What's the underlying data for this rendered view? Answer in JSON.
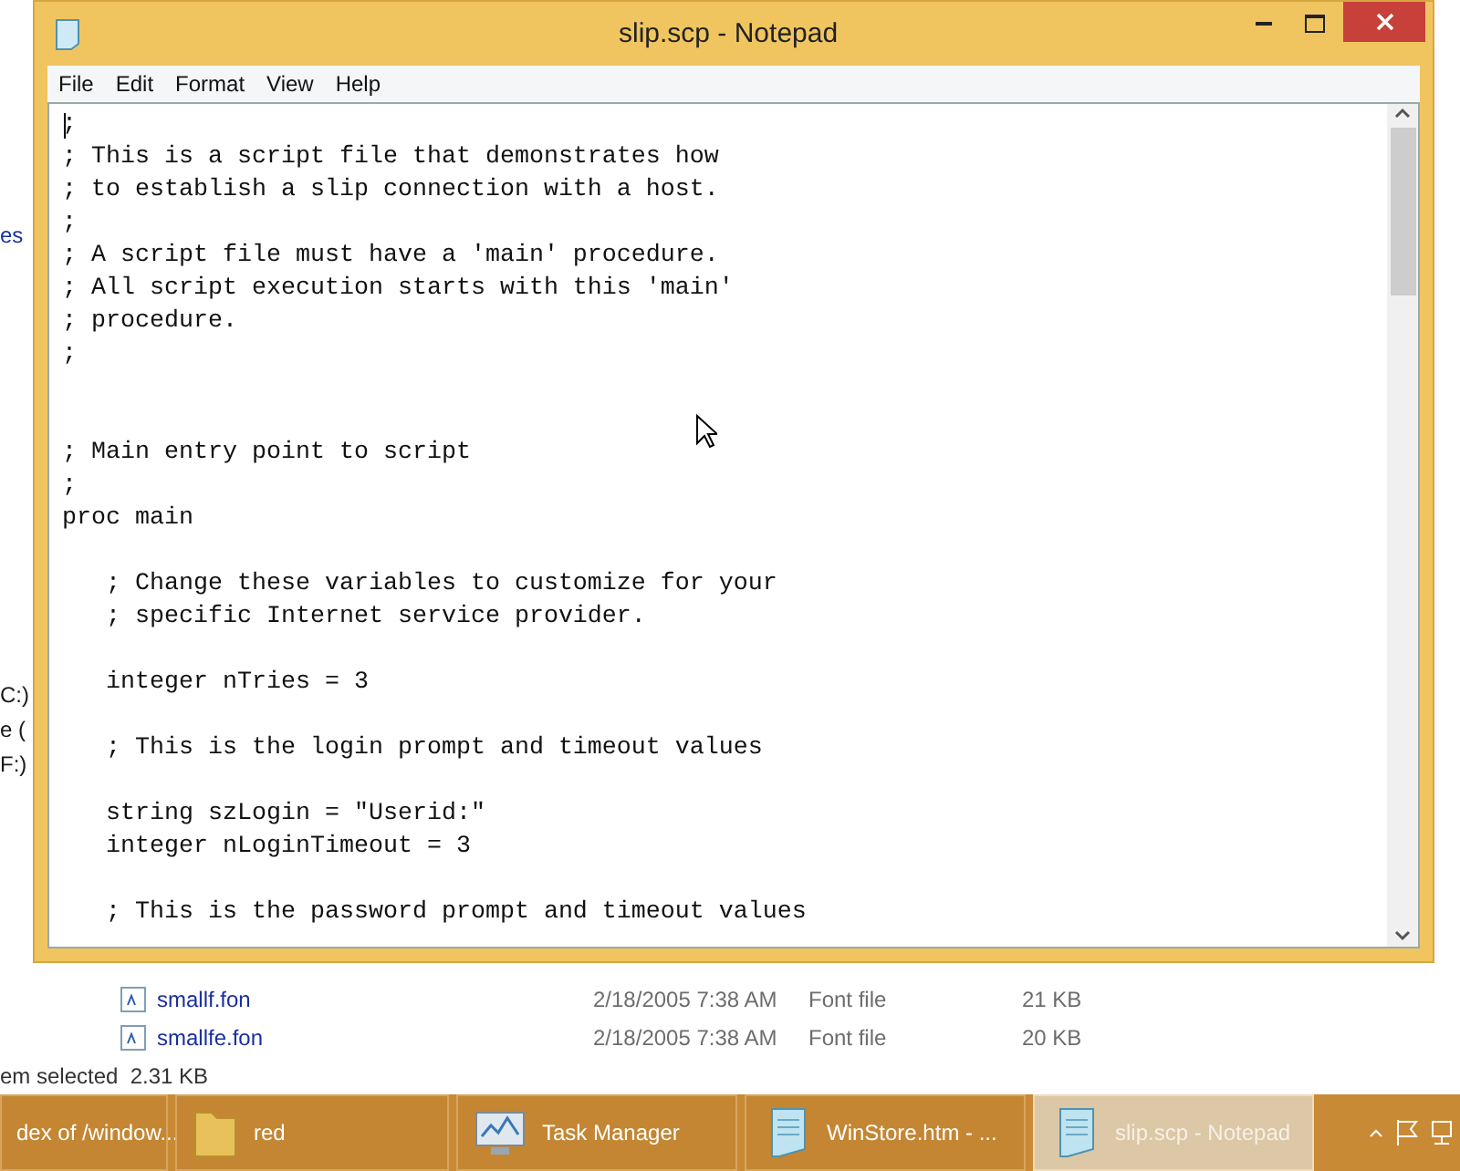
{
  "explorer": {
    "sidebar_items": [
      "es",
      "C:)",
      "e (",
      "F:)"
    ],
    "files": [
      {
        "name": "smallf.fon",
        "date": "2/18/2005 7:38 AM",
        "type": "Font file",
        "size": "21 KB"
      },
      {
        "name": "smallfe.fon",
        "date": "2/18/2005 7:38 AM",
        "type": "Font file",
        "size": "20 KB"
      }
    ],
    "status_bar": "em selected  2.31 KB"
  },
  "notepad": {
    "title": "slip.scp - Notepad",
    "menu": [
      "File",
      "Edit",
      "Format",
      "View",
      "Help"
    ],
    "text": ";\n; This is a script file that demonstrates how\n; to establish a slip connection with a host.\n;\n; A script file must have a 'main' procedure.\n; All script execution starts with this 'main'\n; procedure.\n;\n\n\n; Main entry point to script\n;\nproc main\n\n   ; Change these variables to customize for your\n   ; specific Internet service provider.\n\n   integer nTries = 3\n\n   ; This is the login prompt and timeout values\n\n   string szLogin = \"Userid:\"\n   integer nLoginTimeout = 3\n\n   ; This is the password prompt and timeout values"
  },
  "taskbar": [
    {
      "label": "dex of /window...",
      "kind": "browser",
      "selected": false
    },
    {
      "label": "red",
      "kind": "folder",
      "selected": false
    },
    {
      "label": "Task Manager",
      "kind": "taskmgr",
      "selected": false
    },
    {
      "label": "WinStore.htm - ...",
      "kind": "notepad",
      "selected": false
    },
    {
      "label": "slip.scp - Notepad",
      "kind": "notepad",
      "selected": true
    }
  ]
}
